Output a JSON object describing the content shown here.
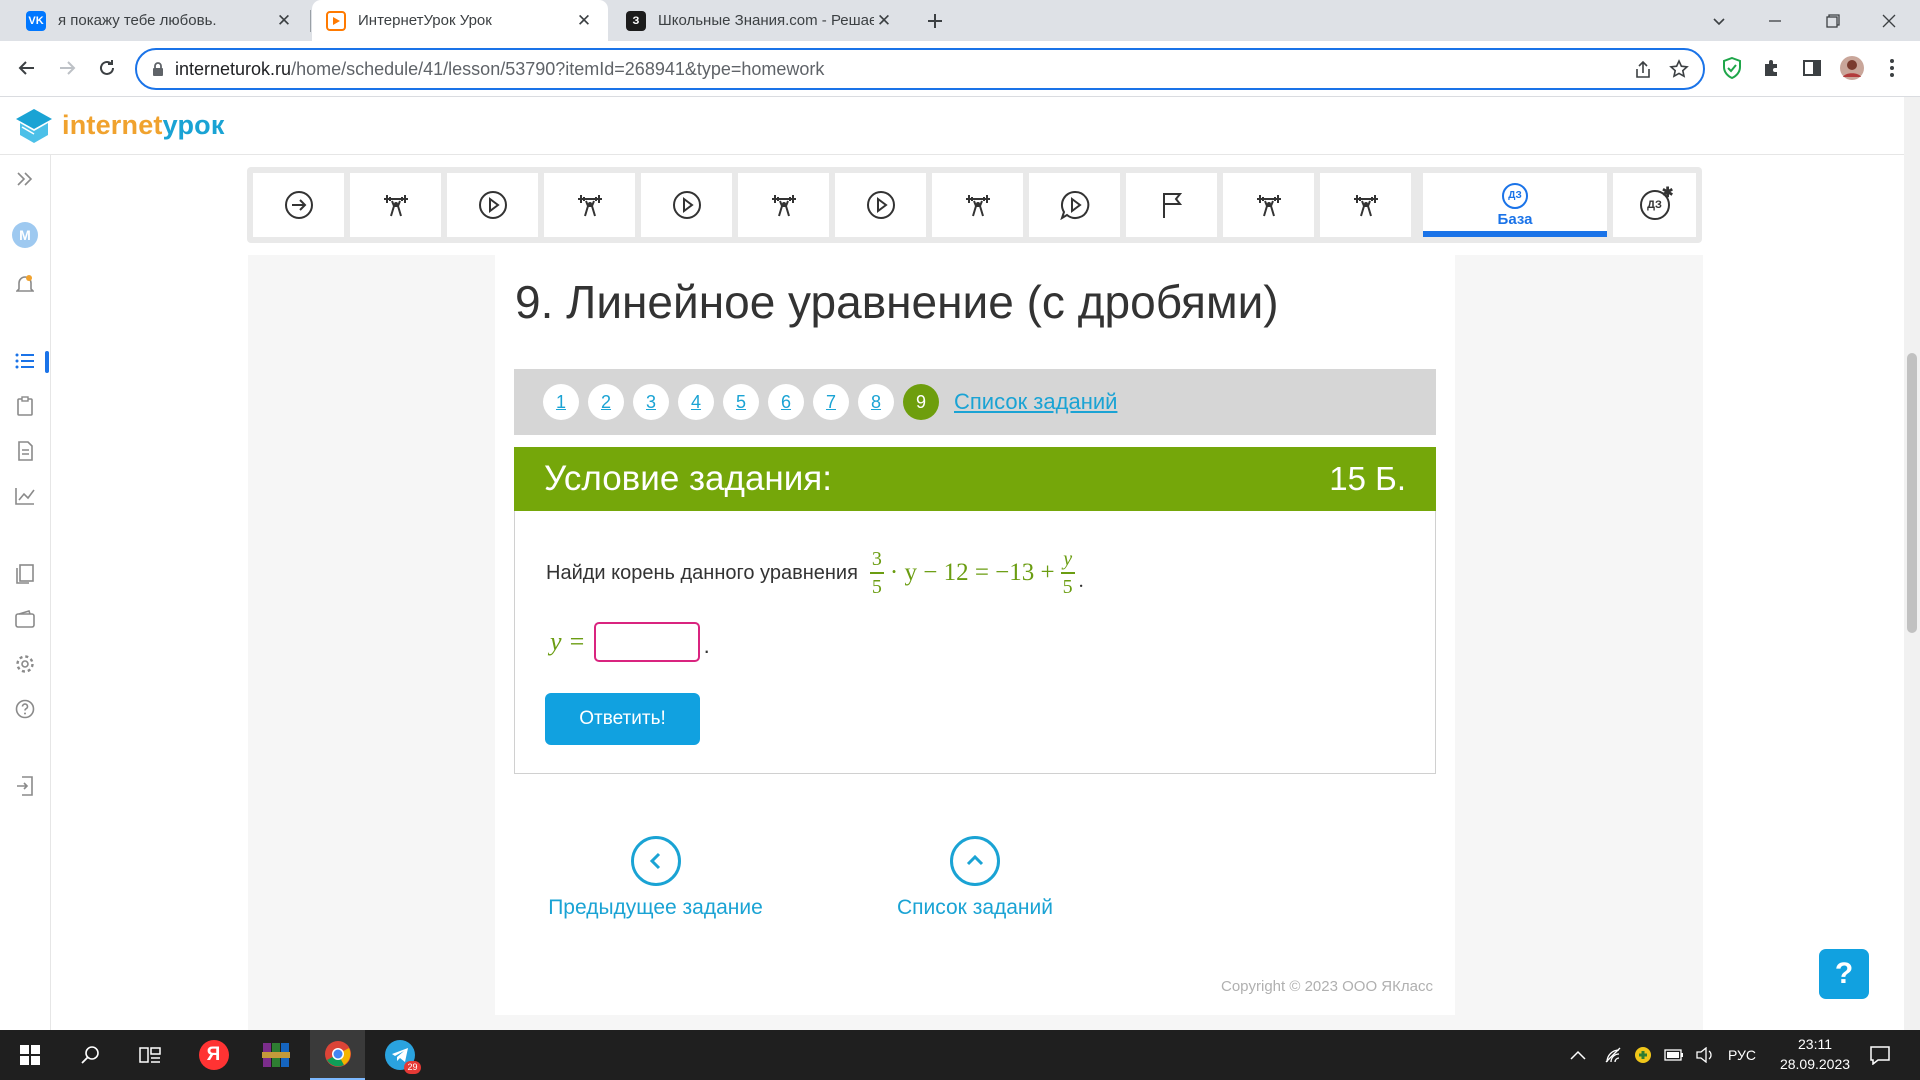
{
  "browser": {
    "tabs": [
      {
        "title": "я покажу тебе любовь.",
        "favicon": "VK",
        "favicon_color": "#0077ff"
      },
      {
        "title": "ИнтернетУрок Урок",
        "favicon": "play",
        "favicon_color": "#ff7a00"
      },
      {
        "title": "Школьные Знания.com - Решае",
        "favicon": "З",
        "favicon_color": "#1c1c1c"
      }
    ],
    "url_domain": "interneturok.ru",
    "url_path": "/home/schedule/41/lesson/53790?itemId=268941&type=homework"
  },
  "site": {
    "logo_left": "internet",
    "logo_right": "урок",
    "sidebar_avatar_letter": "М"
  },
  "lesson_nav": {
    "items": [
      "arrow-right",
      "weight",
      "play",
      "weight",
      "play",
      "weight",
      "play",
      "weight",
      "play-bubble",
      "flag",
      "weight",
      "weight",
      "dz-base",
      "dz-plus"
    ],
    "active_badge": "ДЗ",
    "active_label": "База",
    "last_badge": "ДЗ"
  },
  "task": {
    "title": "9. Линейное уравнение (с дробями)",
    "pages": [
      "1",
      "2",
      "3",
      "4",
      "5",
      "6",
      "7",
      "8",
      "9"
    ],
    "current_page": "9",
    "list_link": "Список заданий",
    "condition_header": "Условие задания:",
    "points": "15 Б.",
    "question_text": "Найди корень данного уравнения",
    "equation": {
      "frac1_num": "3",
      "frac1_den": "5",
      "middle": "· y − 12 = −13 +",
      "frac2_num": "y",
      "frac2_den": "5",
      "end": "."
    },
    "answer_label": "y =",
    "answer_value": "",
    "answer_end": ".",
    "submit_label": "Ответить!"
  },
  "bottom_nav": {
    "prev_label": "Предыдущее задание",
    "list_label": "Список заданий"
  },
  "footer": {
    "copyright": "Copyright © 2023 ООО ЯКласс"
  },
  "help_label": "?",
  "taskbar": {
    "time": "23:11",
    "date": "28.09.2023",
    "language": "РУС",
    "telegram_badge": "29"
  },
  "colors": {
    "brand_blue": "#1aa3d4",
    "brand_green": "#75a70a",
    "accent": "#1a73e8"
  }
}
